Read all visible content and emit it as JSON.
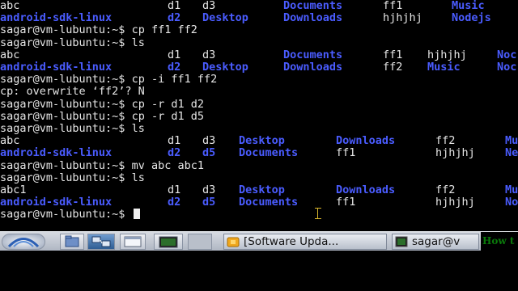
{
  "terminal": {
    "prompt": "sagar@vm-lubuntu:~$ ",
    "lines": [
      {
        "cmd": null,
        "cells": [
          [
            "abc",
            "w",
            0
          ],
          [
            "d1",
            "w",
            207
          ],
          [
            "d3",
            "w",
            250
          ],
          [
            "Documents",
            "b",
            350
          ],
          [
            "ff1",
            "w",
            473
          ],
          [
            "Music",
            "b",
            558
          ]
        ]
      },
      {
        "cmd": null,
        "cells": [
          [
            "android-sdk-linux",
            "b",
            0
          ],
          [
            "d2",
            "b",
            207
          ],
          [
            "Desktop",
            "b",
            250
          ],
          [
            "Downloads",
            "b",
            350
          ],
          [
            "hjhjhj",
            "w",
            473
          ],
          [
            "Nodejs",
            "b",
            558
          ]
        ]
      },
      {
        "cmd": "cp ff1 ff2",
        "cells": []
      },
      {
        "cmd": "ls",
        "cells": []
      },
      {
        "cmd": null,
        "cells": [
          [
            "abc",
            "w",
            0
          ],
          [
            "d1",
            "w",
            207
          ],
          [
            "d3",
            "w",
            250
          ],
          [
            "Documents",
            "b",
            350
          ],
          [
            "ff1",
            "w",
            473
          ],
          [
            "hjhjhj",
            "w",
            528
          ],
          [
            "Noc",
            "b",
            614
          ]
        ]
      },
      {
        "cmd": null,
        "cells": [
          [
            "android-sdk-linux",
            "b",
            0
          ],
          [
            "d2",
            "b",
            207
          ],
          [
            "Desktop",
            "b",
            250
          ],
          [
            "Downloads",
            "b",
            350
          ],
          [
            "ff2",
            "w",
            473
          ],
          [
            "Music",
            "b",
            528
          ],
          [
            "Noc",
            "b",
            614
          ]
        ]
      },
      {
        "cmd": "cp -i ff1 ff2",
        "cells": []
      },
      {
        "cmd": null,
        "cells": [
          [
            "cp: overwrite ‘ff2’? N",
            "w",
            0
          ]
        ]
      },
      {
        "cmd": "cp -r d1 d2",
        "cells": []
      },
      {
        "cmd": "cp -r d1 d5",
        "cells": []
      },
      {
        "cmd": "ls",
        "cells": []
      },
      {
        "cmd": null,
        "cells": [
          [
            "abc",
            "w",
            0
          ],
          [
            "d1",
            "w",
            207
          ],
          [
            "d3",
            "w",
            250
          ],
          [
            "Desktop",
            "b",
            295
          ],
          [
            "Downloads",
            "b",
            415
          ],
          [
            "ff2",
            "w",
            538
          ],
          [
            "Mu",
            "b",
            624
          ]
        ]
      },
      {
        "cmd": null,
        "cells": [
          [
            "android-sdk-linux",
            "b",
            0
          ],
          [
            "d2",
            "b",
            207
          ],
          [
            "d5",
            "b",
            250
          ],
          [
            "Documents",
            "b",
            295
          ],
          [
            "ff1",
            "w",
            415
          ],
          [
            "hjhjhj",
            "w",
            538
          ],
          [
            "Ne",
            "b",
            624
          ]
        ]
      },
      {
        "cmd": "mv abc abc1",
        "cells": []
      },
      {
        "cmd": "ls",
        "cells": []
      },
      {
        "cmd": null,
        "cells": [
          [
            "abc1",
            "w",
            0
          ],
          [
            "d1",
            "w",
            207
          ],
          [
            "d3",
            "w",
            250
          ],
          [
            "Desktop",
            "b",
            295
          ],
          [
            "Downloads",
            "b",
            415
          ],
          [
            "ff2",
            "w",
            538
          ],
          [
            "Mu",
            "b",
            624
          ]
        ]
      },
      {
        "cmd": null,
        "cells": [
          [
            "android-sdk-linux",
            "b",
            0
          ],
          [
            "d2",
            "b",
            207
          ],
          [
            "d5",
            "b",
            250
          ],
          [
            "Documents",
            "b",
            295
          ],
          [
            "ff1",
            "w",
            415
          ],
          [
            "hjhjhj",
            "w",
            538
          ],
          [
            "No",
            "b",
            624
          ]
        ]
      },
      {
        "cmd": "",
        "cells": [],
        "cursor": true
      }
    ]
  },
  "taskbar": {
    "tasks": {
      "software_update": "[Software Upda...",
      "terminal": "sagar@v"
    },
    "right_label": "How t"
  },
  "colors": {
    "dir": "#4a5cff",
    "text": "#e6e6e6",
    "taskbar": "#c4cad4"
  },
  "icons": [
    "start-menu-icon",
    "file-manager-icon",
    "network-icon",
    "window-icon",
    "terminal-icon",
    "software-update-icon",
    "terminal-task-icon"
  ]
}
